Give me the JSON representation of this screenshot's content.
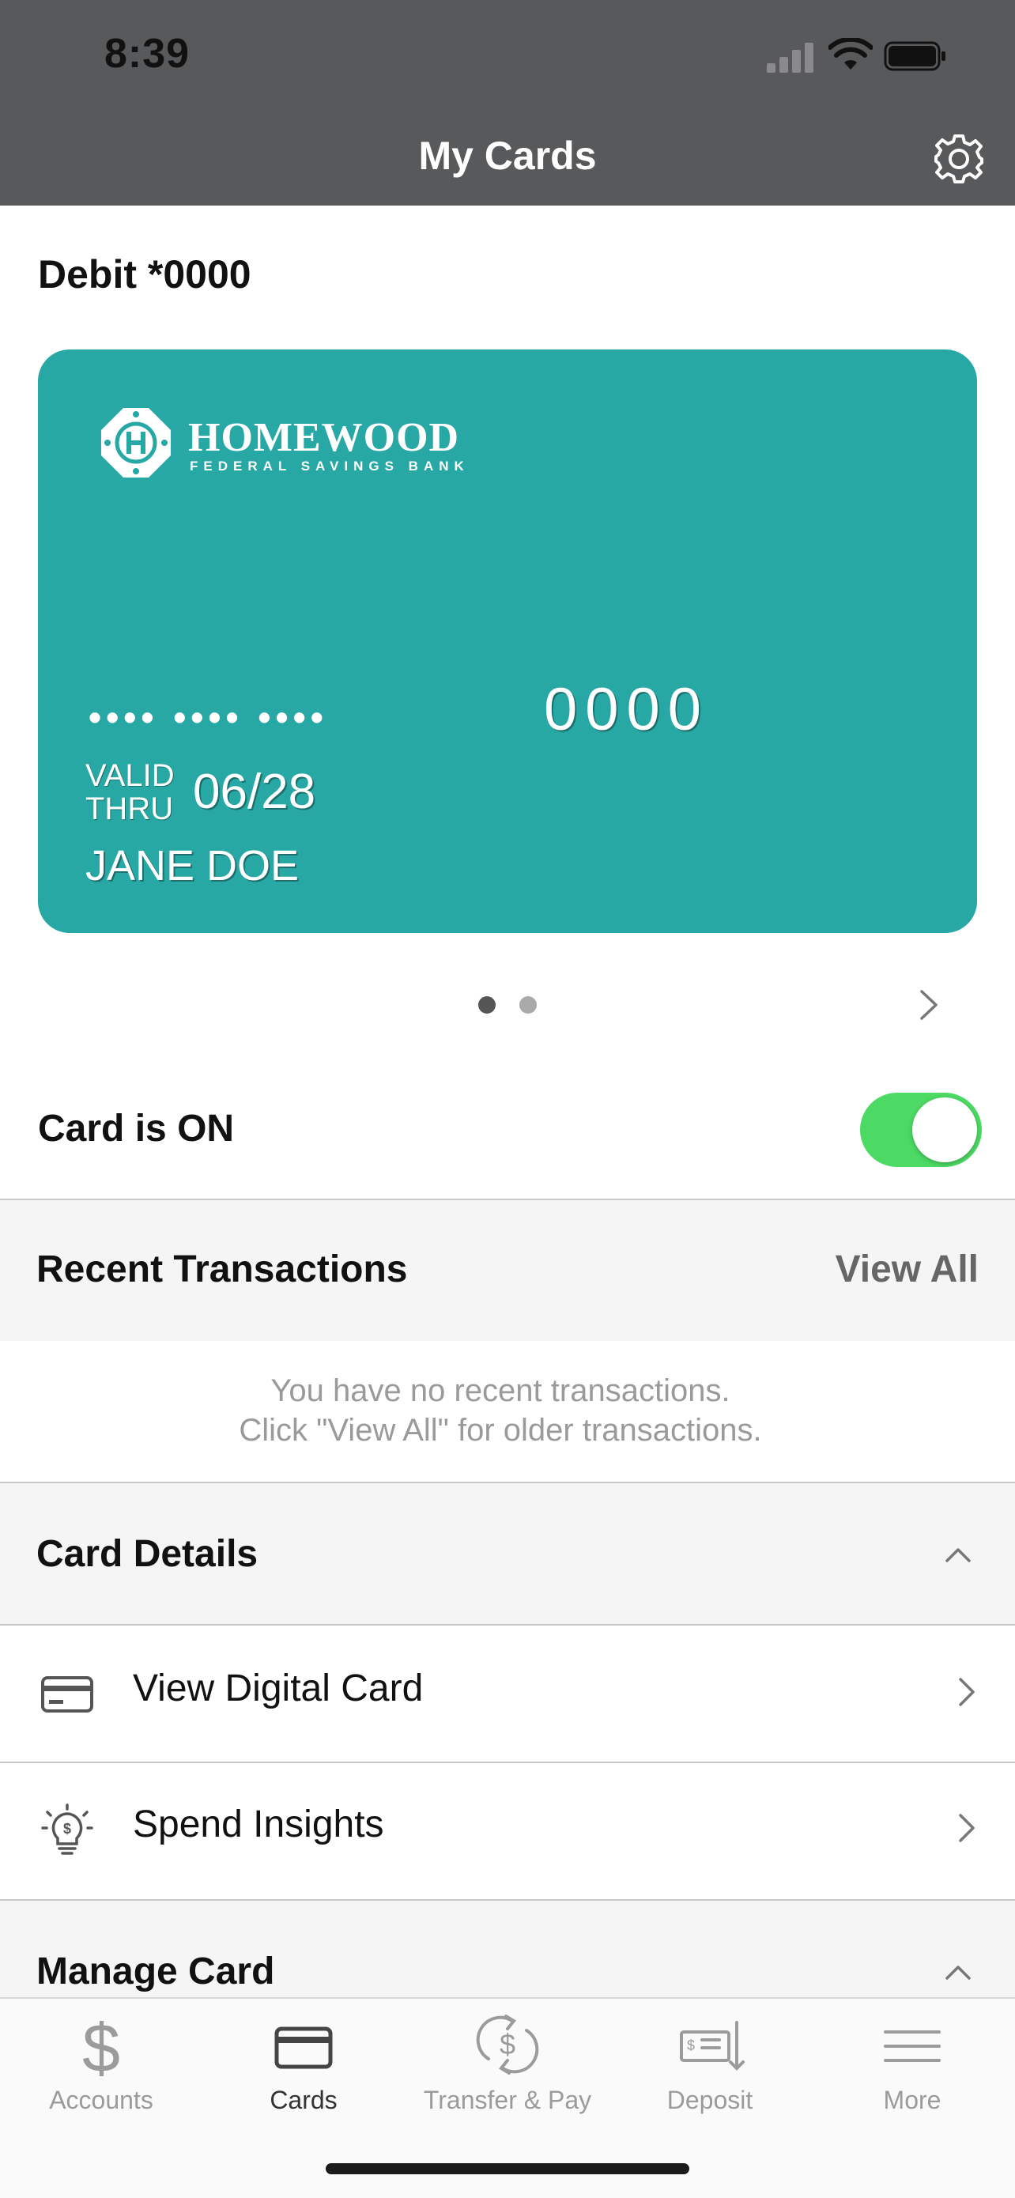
{
  "status_bar": {
    "time": "8:39"
  },
  "header": {
    "title": "My Cards"
  },
  "card_section": {
    "label": "Debit *0000",
    "card": {
      "bank_name": "HOMEWOOD",
      "bank_subtitle": "FEDERAL SAVINGS BANK",
      "masked_groups": "••••  ••••  ••••",
      "last4": "0000",
      "valid_thru": "VALID THRU",
      "expiry": "06/28",
      "holder": "JANE DOE",
      "color": "#27a8a5"
    },
    "pager": {
      "pages": 2,
      "current": 1
    }
  },
  "card_toggle": {
    "label": "Card is ON",
    "on": true,
    "color": "#4cd964"
  },
  "recent_transactions": {
    "title": "Recent Transactions",
    "view_all": "View All",
    "empty_line1": "You have no recent transactions.",
    "empty_line2": "Click \"View All\" for older transactions."
  },
  "card_details": {
    "title": "Card Details",
    "expanded": true,
    "items": [
      {
        "label": "View Digital Card",
        "icon": "credit-card-icon"
      },
      {
        "label": "Spend Insights",
        "icon": "lightbulb-dollar-icon"
      }
    ]
  },
  "manage_card": {
    "title": "Manage Card",
    "expanded": true
  },
  "tab_bar": {
    "active": "Cards",
    "tabs": [
      {
        "label": "Accounts",
        "icon": "dollar-icon"
      },
      {
        "label": "Cards",
        "icon": "card-icon"
      },
      {
        "label": "Transfer & Pay",
        "icon": "transfer-icon"
      },
      {
        "label": "Deposit",
        "icon": "check-deposit-icon"
      },
      {
        "label": "More",
        "icon": "menu-icon"
      }
    ]
  }
}
